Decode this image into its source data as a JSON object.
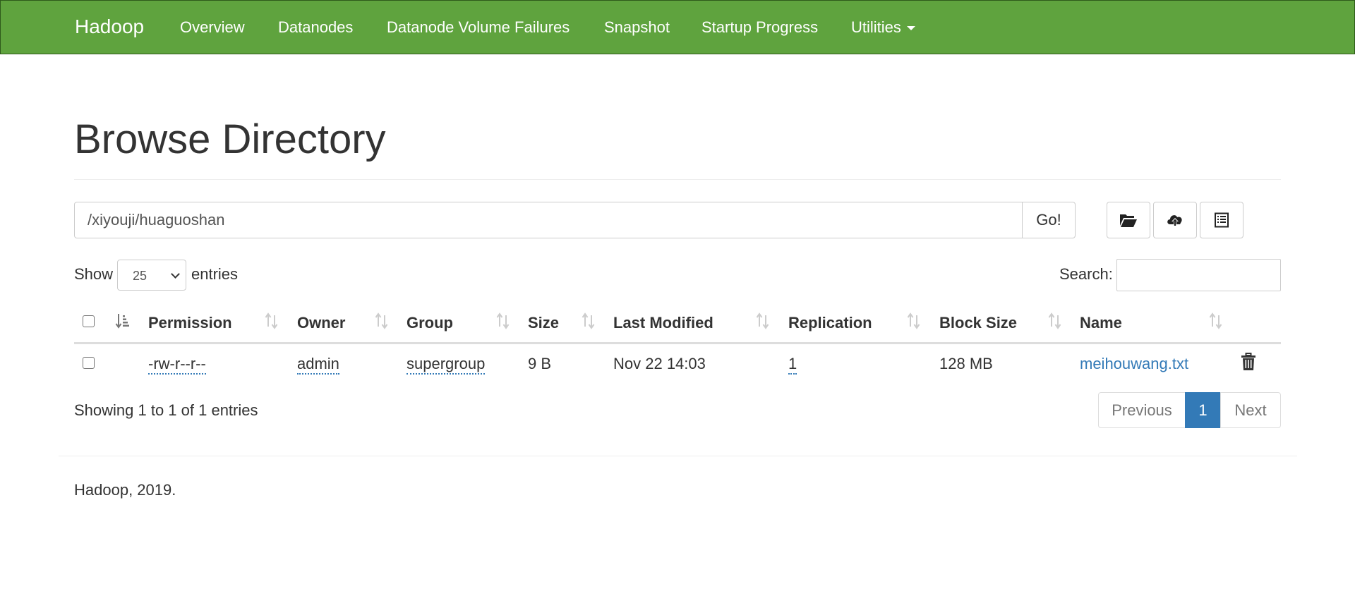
{
  "navbar": {
    "brand": "Hadoop",
    "items": [
      {
        "label": "Overview"
      },
      {
        "label": "Datanodes"
      },
      {
        "label": "Datanode Volume Failures"
      },
      {
        "label": "Snapshot"
      },
      {
        "label": "Startup Progress"
      },
      {
        "label": "Utilities"
      }
    ],
    "bg_color": "#5fa33e"
  },
  "page": {
    "title": "Browse Directory"
  },
  "path_bar": {
    "value": "/xiyouji/huaguoshan",
    "go_label": "Go!",
    "tools": [
      "folder-open-icon",
      "cloud-upload-icon",
      "list-icon"
    ]
  },
  "table_controls": {
    "show_label": "Show",
    "entries_value": "25",
    "entries_label": "entries",
    "search_label": "Search:",
    "search_value": ""
  },
  "table": {
    "columns": [
      "Permission",
      "Owner",
      "Group",
      "Size",
      "Last Modified",
      "Replication",
      "Block Size",
      "Name"
    ],
    "rows": [
      {
        "permission": "-rw-r--r--",
        "owner": "admin",
        "group": "supergroup",
        "size": "9 B",
        "last_modified": "Nov 22 14:03",
        "replication": "1",
        "block_size": "128 MB",
        "name": "meihouwang.txt"
      }
    ],
    "link_color": "#337ab7"
  },
  "pagination": {
    "info": "Showing 1 to 1 of 1 entries",
    "previous": "Previous",
    "current": "1",
    "next": "Next",
    "active_color": "#337ab7"
  },
  "footer": {
    "text": "Hadoop, 2019."
  }
}
